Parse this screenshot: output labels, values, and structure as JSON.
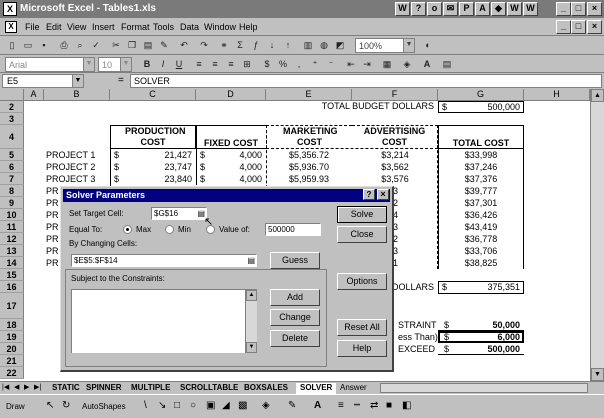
{
  "window": {
    "title": "Microsoft Excel - Tables1.xls",
    "app_min": "_",
    "app_max": "□",
    "app_close": "×",
    "doc_min": "_",
    "doc_max": "□",
    "doc_close": "×"
  },
  "menu": {
    "items": [
      "File",
      "Edit",
      "View",
      "Insert",
      "Format",
      "Tools",
      "Data",
      "Window",
      "Help"
    ]
  },
  "toolbar": {
    "zoom": "100%",
    "font_name": "Arial",
    "font_size": "10",
    "bold": "B",
    "italic": "I",
    "underline": "U",
    "currency": "$",
    "percent": "%",
    "comma": ","
  },
  "formula": {
    "name_box": "E5",
    "eq": "=",
    "content": "SOLVER"
  },
  "columns": [
    "A",
    "B",
    "C",
    "D",
    "E",
    "F",
    "G",
    "H"
  ],
  "rows": [
    "2",
    "3",
    "4",
    "5",
    "6",
    "7",
    "8",
    "9",
    "10",
    "11",
    "12",
    "13",
    "14",
    "15",
    "16",
    "17",
    "18",
    "19",
    "20",
    "21",
    "22"
  ],
  "sheet": {
    "total_budget_label": "TOTAL BUDGET DOLLARS",
    "total_budget_cur": "$",
    "total_budget_value": "500,000",
    "hdr_production": "PRODUCTION COST",
    "hdr_fixed": "FIXED COST",
    "hdr_marketing": "MARKETING COST",
    "hdr_advertising": "ADVERTISING COST",
    "hdr_total": "TOTAL COST",
    "projects": [
      {
        "name": "PROJECT 1",
        "cur": "$",
        "prod": "21,427",
        "fcur": "$",
        "fixed": "4,000",
        "mkt": "$5,356.72",
        "adv": "$3,214",
        "total": "$33,998"
      },
      {
        "name": "PROJECT 2",
        "cur": "$",
        "prod": "23,747",
        "fcur": "$",
        "fixed": "4,000",
        "mkt": "$5,936.70",
        "adv": "$3,562",
        "total": "$37,246"
      },
      {
        "name": "PROJECT 3",
        "cur": "$",
        "prod": "23,840",
        "fcur": "$",
        "fixed": "4,000",
        "mkt": "$5,959.93",
        "adv": "$3,576",
        "total": "$37,376"
      },
      {
        "name": "PR",
        "adv": "33",
        "total": "$39,777"
      },
      {
        "name": "PR",
        "adv": "22",
        "total": "$37,301"
      },
      {
        "name": "PR",
        "adv": "74",
        "total": "$36,426"
      },
      {
        "name": "PR",
        "adv": "23",
        "total": "$43,419"
      },
      {
        "name": "PR",
        "adv": "12",
        "total": "$36,778"
      },
      {
        "name": "PR",
        "adv": "83",
        "total": "$33,706"
      },
      {
        "name": "PR",
        "adv": "31",
        "total": "$38,825"
      }
    ],
    "row16_label": "DOLLARS",
    "row16_cur": "$",
    "row16_value": "375,351",
    "row18_label": "STRAINT",
    "row18_cur": "$",
    "row18_value": "50,000",
    "row19_label": "ess Than)",
    "row19_cur": "$",
    "row19_value": "6,000",
    "row20_label": "EXCEED",
    "row20_cur": "$",
    "row20_value": "500,000"
  },
  "solver": {
    "title": "Solver Parameters",
    "help_q": "?",
    "close_x": "×",
    "set_target_label": "Set Target Cell:",
    "set_target_value": "$G$16",
    "equal_to_label": "Equal To:",
    "opt_max": "Max",
    "opt_min": "Min",
    "opt_value": "Value of:",
    "value_of": "500000",
    "by_changing_label": "By Changing Cells:",
    "by_changing_value": "$E$5:$F$14",
    "guess": "Guess",
    "constraints_label": "Subject to the Constraints:",
    "solve": "Solve",
    "close": "Close",
    "options": "Options",
    "add": "Add",
    "change": "Change",
    "delete": "Delete",
    "reset_all": "Reset All",
    "help": "Help"
  },
  "tabs": [
    "STATIC",
    "SPINNER",
    "MULTIPLE",
    "SCROLLTABLE",
    "BOXSALES",
    "SOLVER",
    "Answer"
  ],
  "drawing": {
    "draw": "Draw",
    "autoshapes": "AutoShapes"
  }
}
